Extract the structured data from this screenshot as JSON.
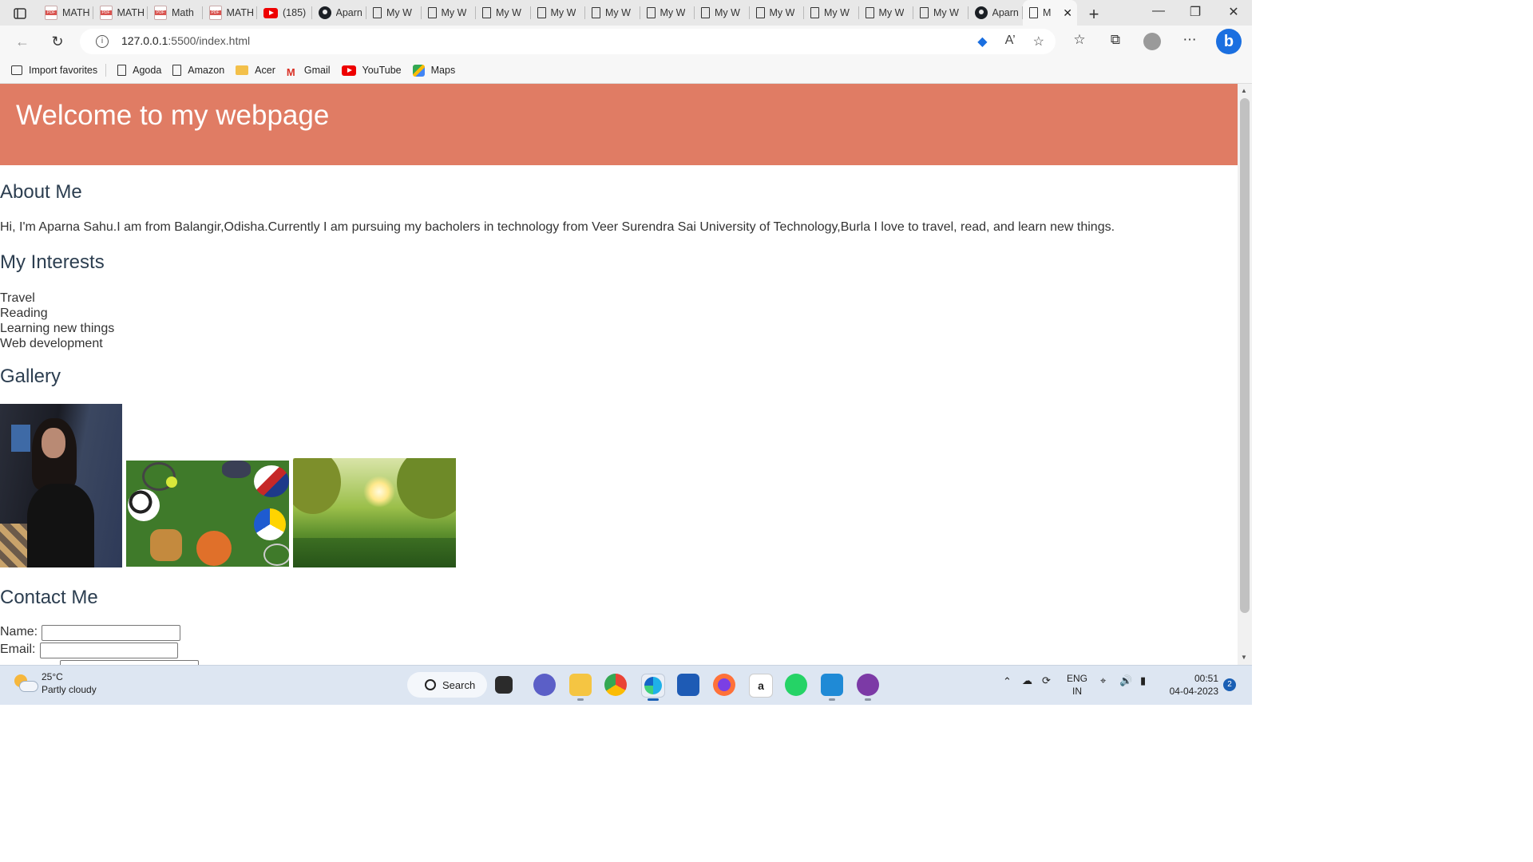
{
  "browser": {
    "tabs": [
      {
        "icon": "pdf-icon",
        "label": "MATH"
      },
      {
        "icon": "pdf-icon",
        "label": "MATH"
      },
      {
        "icon": "pdf-icon",
        "label": "Math"
      },
      {
        "icon": "pdf-icon",
        "label": "MATH"
      },
      {
        "icon": "youtube-icon",
        "label": "(185)"
      },
      {
        "icon": "github-icon",
        "label": "Aparn"
      },
      {
        "icon": "doc-icon",
        "label": "My W"
      },
      {
        "icon": "doc-icon",
        "label": "My W"
      },
      {
        "icon": "doc-icon",
        "label": "My W"
      },
      {
        "icon": "doc-icon",
        "label": "My W"
      },
      {
        "icon": "doc-icon",
        "label": "My W"
      },
      {
        "icon": "doc-icon",
        "label": "My W"
      },
      {
        "icon": "doc-icon",
        "label": "My W"
      },
      {
        "icon": "doc-icon",
        "label": "My W"
      },
      {
        "icon": "doc-icon",
        "label": "My W"
      },
      {
        "icon": "doc-icon",
        "label": "My W"
      },
      {
        "icon": "doc-icon",
        "label": "My W"
      },
      {
        "icon": "github-icon",
        "label": "Aparn"
      }
    ],
    "active_tab": {
      "icon": "doc-icon",
      "label": "M"
    },
    "url_host": "127.0.0.1",
    "url_path": ":5500/index.html",
    "favorites": [
      {
        "icon": "import-icon",
        "label": "Import favorites"
      },
      {
        "icon": "doc-icon",
        "label": "Agoda"
      },
      {
        "icon": "doc-icon",
        "label": "Amazon"
      },
      {
        "icon": "folder-icon",
        "label": "Acer"
      },
      {
        "icon": "gmail-icon",
        "label": "Gmail"
      },
      {
        "icon": "youtube-icon",
        "label": "YouTube"
      },
      {
        "icon": "maps-icon",
        "label": "Maps"
      }
    ]
  },
  "page": {
    "hero_title": "Welcome to my webpage",
    "hero_color": "#e07c64",
    "about_heading": "About Me",
    "about_text": "Hi, I'm Aparna Sahu.I am from Balangir,Odisha.Currently I am pursuing my bacholers in technology from Veer Surendra Sai University of Technology,Burla I love to travel, read, and learn new things.",
    "interests_heading": "My Interests",
    "interests": [
      "Travel",
      "Reading",
      "Learning new things",
      "Web development"
    ],
    "gallery_heading": "Gallery",
    "contact_heading": "Contact Me",
    "contact_form": {
      "name_label": "Name:",
      "name_value": "",
      "email_label": "Email:",
      "email_value": ""
    }
  },
  "taskbar": {
    "weather_temp": "25°C",
    "weather_desc": "Partly cloudy",
    "search_label": "Search",
    "lang_top": "ENG",
    "lang_bottom": "IN",
    "time": "00:51",
    "date": "04-04-2023",
    "notification_count": "2"
  }
}
